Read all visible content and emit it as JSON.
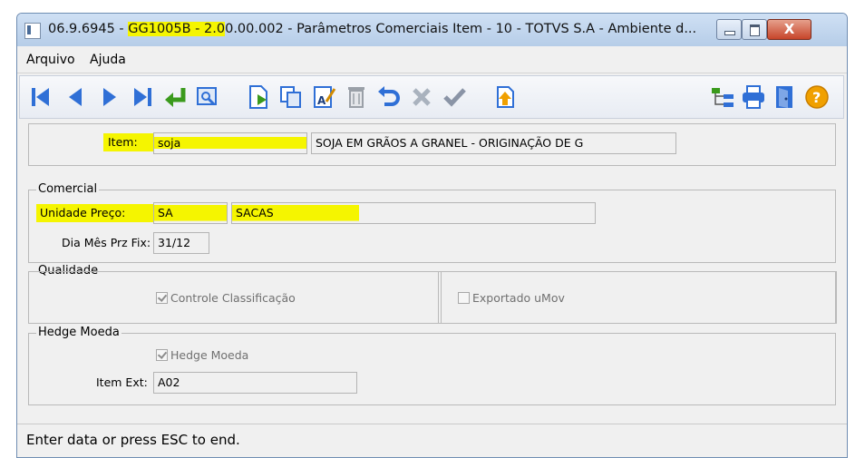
{
  "window": {
    "title_prefix": "06.9.6945 - ",
    "title_highlight": "GG1005B - 2.0",
    "title_rest": "0.00.002 - Parâmetros Comerciais Item - 10 - TOTVS S.A - Ambiente d...",
    "close_glyph": "X"
  },
  "menu": [
    "Arquivo",
    "Ajuda"
  ],
  "toolbar": {
    "icons": [
      "first-record-icon",
      "previous-record-icon",
      "next-record-icon",
      "last-record-icon",
      "return-icon",
      "search-icon",
      "new-record-icon",
      "copy-record-icon",
      "edit-record-icon",
      "delete-record-icon",
      "undo-icon",
      "cancel-icon",
      "save-icon",
      "import-icon",
      "tree-icon",
      "print-icon",
      "exit-icon",
      "help-icon"
    ]
  },
  "item": {
    "label": "Item:",
    "value": "soja",
    "description": "SOJA EM GRÃOS A GRANEL - ORIGINAÇÃO DE G"
  },
  "comercial": {
    "legend": "Comercial",
    "unidade_label": "Unidade Preço:",
    "unidade_value": "SA",
    "unidade_desc": "SACAS",
    "dia_label": "Dia Mês Prz Fix:",
    "dia_value": "31/12"
  },
  "qualidade": {
    "legend": "Qualidade",
    "controle_label": "Controle Classificação",
    "controle_checked": true,
    "exportado_label": "Exportado uMov",
    "exportado_checked": false
  },
  "hedge": {
    "legend": "Hedge Moeda",
    "hedge_label": "Hedge Moeda",
    "hedge_checked": true,
    "item_ext_label": "Item Ext:",
    "item_ext_value": "A02"
  },
  "status": "Enter data or press ESC to end.",
  "colors": {
    "highlight": "#f5f500",
    "toolbar_blue": "#2f6fd6",
    "green_arrow": "#3a9a1c",
    "help_orange": "#f0a000"
  }
}
